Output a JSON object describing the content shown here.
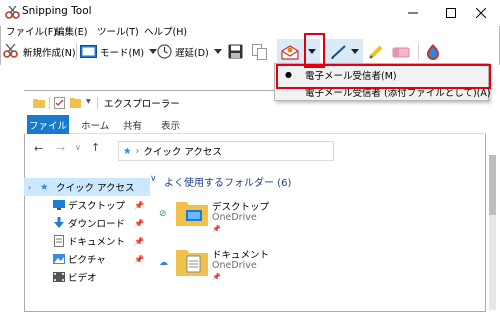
{
  "window": {
    "title": "Snipping Tool",
    "controls": [
      "minimize",
      "maximize",
      "close"
    ]
  },
  "menubar": {
    "items": [
      "ファイル(F)",
      "編集(E)",
      "ツール(T)",
      "ヘルプ(H)"
    ]
  },
  "toolbar": {
    "new_label": "新規作成(N)",
    "mode_label": "モード(M)",
    "delay_label": "遅延(D)",
    "icons": [
      "scissors-icon",
      "mode-icon",
      "clock-icon",
      "save-icon",
      "copy-icon",
      "email-icon",
      "pen-icon",
      "highlighter-icon",
      "eraser-icon",
      "paint3d-icon"
    ]
  },
  "send_menu": {
    "items": [
      {
        "label": "電子メール受信者(M)",
        "selected": true
      },
      {
        "label": "電子メール受信者 (添付ファイルとして)(A)",
        "selected": false
      }
    ]
  },
  "explorer": {
    "title": "エクスプローラー",
    "ribbon_tabs": [
      "ファイル",
      "ホーム",
      "共有",
      "表示"
    ],
    "address": "クイック アクセス",
    "nav_items": [
      {
        "label": "クイック アクセス",
        "icon": "star-icon",
        "pinned": false,
        "selected": true
      },
      {
        "label": "デスクトップ",
        "icon": "desktop-icon",
        "pinned": true
      },
      {
        "label": "ダウンロード",
        "icon": "download-icon",
        "pinned": true
      },
      {
        "label": "ドキュメント",
        "icon": "document-icon",
        "pinned": true
      },
      {
        "label": "ピクチャ",
        "icon": "picture-icon",
        "pinned": true
      },
      {
        "label": "ビデオ",
        "icon": "video-icon",
        "pinned": false
      }
    ],
    "section_title": "よく使用するフォルダー (6)",
    "folders": [
      {
        "name": "デスクトップ",
        "location": "OneDrive",
        "status": "synced"
      },
      {
        "name": "ドキュメント",
        "location": "OneDrive",
        "status": "cloud"
      }
    ]
  },
  "colors": {
    "highlight_red": "#e00012",
    "ribbon_blue": "#1979ca",
    "selected_bg": "#cce8ff",
    "menu_bg": "#f2f2f2"
  }
}
